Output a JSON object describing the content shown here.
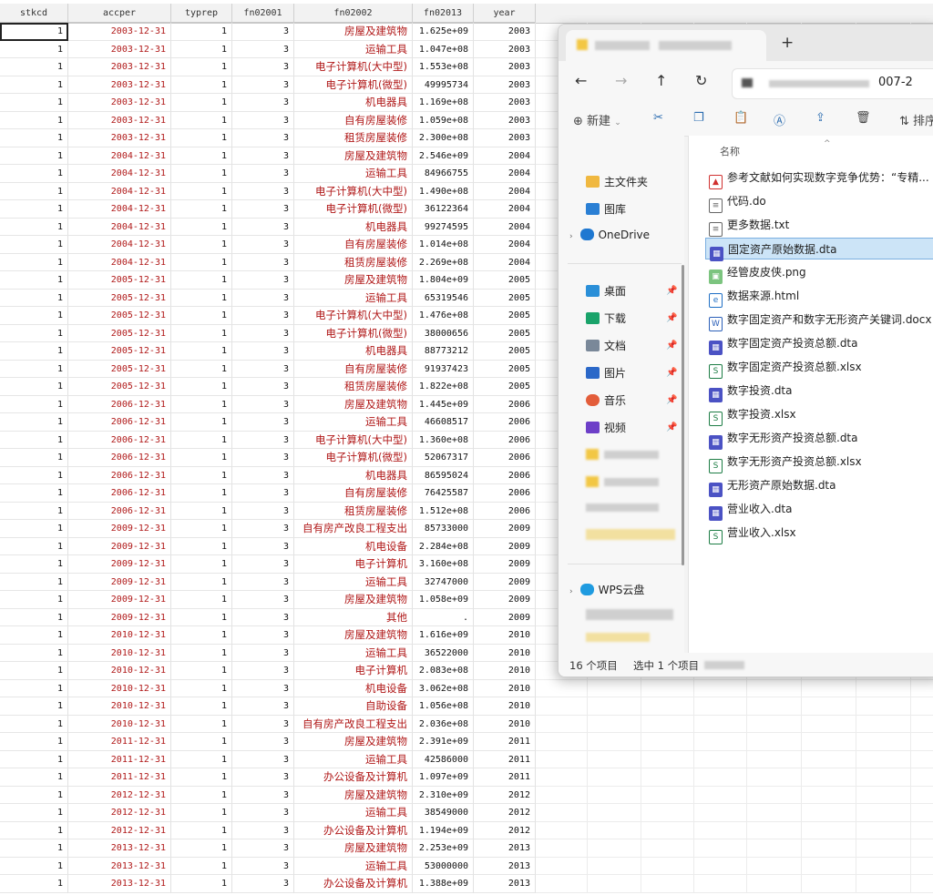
{
  "grid": {
    "columns": [
      "stkcd",
      "accper",
      "typrep",
      "fn02001",
      "fn02002",
      "fn02013",
      "year"
    ],
    "rows": [
      [
        "1",
        "2003-12-31",
        "1",
        "3",
        "房屋及建筑物",
        "1.625e+09",
        "2003"
      ],
      [
        "1",
        "2003-12-31",
        "1",
        "3",
        "运输工具",
        "1.047e+08",
        "2003"
      ],
      [
        "1",
        "2003-12-31",
        "1",
        "3",
        "电子计算机(大中型)",
        "1.553e+08",
        "2003"
      ],
      [
        "1",
        "2003-12-31",
        "1",
        "3",
        "电子计算机(微型)",
        "49995734",
        "2003"
      ],
      [
        "1",
        "2003-12-31",
        "1",
        "3",
        "机电器具",
        "1.169e+08",
        "2003"
      ],
      [
        "1",
        "2003-12-31",
        "1",
        "3",
        "自有房屋装修",
        "1.059e+08",
        "2003"
      ],
      [
        "1",
        "2003-12-31",
        "1",
        "3",
        "租赁房屋装修",
        "2.300e+08",
        "2003"
      ],
      [
        "1",
        "2004-12-31",
        "1",
        "3",
        "房屋及建筑物",
        "2.546e+09",
        "2004"
      ],
      [
        "1",
        "2004-12-31",
        "1",
        "3",
        "运输工具",
        "84966755",
        "2004"
      ],
      [
        "1",
        "2004-12-31",
        "1",
        "3",
        "电子计算机(大中型)",
        "1.490e+08",
        "2004"
      ],
      [
        "1",
        "2004-12-31",
        "1",
        "3",
        "电子计算机(微型)",
        "36122364",
        "2004"
      ],
      [
        "1",
        "2004-12-31",
        "1",
        "3",
        "机电器具",
        "99274595",
        "2004"
      ],
      [
        "1",
        "2004-12-31",
        "1",
        "3",
        "自有房屋装修",
        "1.014e+08",
        "2004"
      ],
      [
        "1",
        "2004-12-31",
        "1",
        "3",
        "租赁房屋装修",
        "2.269e+08",
        "2004"
      ],
      [
        "1",
        "2005-12-31",
        "1",
        "3",
        "房屋及建筑物",
        "1.804e+09",
        "2005"
      ],
      [
        "1",
        "2005-12-31",
        "1",
        "3",
        "运输工具",
        "65319546",
        "2005"
      ],
      [
        "1",
        "2005-12-31",
        "1",
        "3",
        "电子计算机(大中型)",
        "1.476e+08",
        "2005"
      ],
      [
        "1",
        "2005-12-31",
        "1",
        "3",
        "电子计算机(微型)",
        "38000656",
        "2005"
      ],
      [
        "1",
        "2005-12-31",
        "1",
        "3",
        "机电器具",
        "88773212",
        "2005"
      ],
      [
        "1",
        "2005-12-31",
        "1",
        "3",
        "自有房屋装修",
        "91937423",
        "2005"
      ],
      [
        "1",
        "2005-12-31",
        "1",
        "3",
        "租赁房屋装修",
        "1.822e+08",
        "2005"
      ],
      [
        "1",
        "2006-12-31",
        "1",
        "3",
        "房屋及建筑物",
        "1.445e+09",
        "2006"
      ],
      [
        "1",
        "2006-12-31",
        "1",
        "3",
        "运输工具",
        "46608517",
        "2006"
      ],
      [
        "1",
        "2006-12-31",
        "1",
        "3",
        "电子计算机(大中型)",
        "1.360e+08",
        "2006"
      ],
      [
        "1",
        "2006-12-31",
        "1",
        "3",
        "电子计算机(微型)",
        "52067317",
        "2006"
      ],
      [
        "1",
        "2006-12-31",
        "1",
        "3",
        "机电器具",
        "86595024",
        "2006"
      ],
      [
        "1",
        "2006-12-31",
        "1",
        "3",
        "自有房屋装修",
        "76425587",
        "2006"
      ],
      [
        "1",
        "2006-12-31",
        "1",
        "3",
        "租赁房屋装修",
        "1.512e+08",
        "2006"
      ],
      [
        "1",
        "2009-12-31",
        "1",
        "3",
        "自有房产改良工程支出",
        "85733000",
        "2009"
      ],
      [
        "1",
        "2009-12-31",
        "1",
        "3",
        "机电设备",
        "2.284e+08",
        "2009"
      ],
      [
        "1",
        "2009-12-31",
        "1",
        "3",
        "电子计算机",
        "3.160e+08",
        "2009"
      ],
      [
        "1",
        "2009-12-31",
        "1",
        "3",
        "运输工具",
        "32747000",
        "2009"
      ],
      [
        "1",
        "2009-12-31",
        "1",
        "3",
        "房屋及建筑物",
        "1.058e+09",
        "2009"
      ],
      [
        "1",
        "2009-12-31",
        "1",
        "3",
        "其他",
        ".",
        "2009"
      ],
      [
        "1",
        "2010-12-31",
        "1",
        "3",
        "房屋及建筑物",
        "1.616e+09",
        "2010"
      ],
      [
        "1",
        "2010-12-31",
        "1",
        "3",
        "运输工具",
        "36522000",
        "2010"
      ],
      [
        "1",
        "2010-12-31",
        "1",
        "3",
        "电子计算机",
        "2.083e+08",
        "2010"
      ],
      [
        "1",
        "2010-12-31",
        "1",
        "3",
        "机电设备",
        "3.062e+08",
        "2010"
      ],
      [
        "1",
        "2010-12-31",
        "1",
        "3",
        "自助设备",
        "1.056e+08",
        "2010"
      ],
      [
        "1",
        "2010-12-31",
        "1",
        "3",
        "自有房产改良工程支出",
        "2.036e+08",
        "2010"
      ],
      [
        "1",
        "2011-12-31",
        "1",
        "3",
        "房屋及建筑物",
        "2.391e+09",
        "2011"
      ],
      [
        "1",
        "2011-12-31",
        "1",
        "3",
        "运输工具",
        "42586000",
        "2011"
      ],
      [
        "1",
        "2011-12-31",
        "1",
        "3",
        "办公设备及计算机",
        "1.097e+09",
        "2011"
      ],
      [
        "1",
        "2012-12-31",
        "1",
        "3",
        "房屋及建筑物",
        "2.310e+09",
        "2012"
      ],
      [
        "1",
        "2012-12-31",
        "1",
        "3",
        "运输工具",
        "38549000",
        "2012"
      ],
      [
        "1",
        "2012-12-31",
        "1",
        "3",
        "办公设备及计算机",
        "1.194e+09",
        "2012"
      ],
      [
        "1",
        "2013-12-31",
        "1",
        "3",
        "房屋及建筑物",
        "2.253e+09",
        "2013"
      ],
      [
        "1",
        "2013-12-31",
        "1",
        "3",
        "运输工具",
        "53000000",
        "2013"
      ],
      [
        "1",
        "2013-12-31",
        "1",
        "3",
        "办公设备及计算机",
        "1.388e+09",
        "2013"
      ]
    ]
  },
  "explorer": {
    "new_tab_icon": "+",
    "address_suffix": "007-2",
    "nav": {
      "back": "←",
      "forward": "→",
      "up": "↑",
      "refresh": "↻"
    },
    "toolbar": {
      "new_label": "新建",
      "sort_label": "排序"
    },
    "sidebar": {
      "home": "主文件夹",
      "gallery": "图库",
      "onedrive": "OneDrive",
      "desktop": "桌面",
      "downloads": "下载",
      "documents": "文档",
      "pictures": "图片",
      "music": "音乐",
      "videos": "视频",
      "wps": "WPS云盘"
    },
    "column_name": "名称",
    "files": [
      {
        "name": "参考文献如何实现数字竞争优势：“专精...",
        "type": "pdf"
      },
      {
        "name": "代码.do",
        "type": "doc"
      },
      {
        "name": "更多数据.txt",
        "type": "txt"
      },
      {
        "name": "固定资产原始数据.dta",
        "type": "dta"
      },
      {
        "name": "经管皮皮侠.png",
        "type": "png"
      },
      {
        "name": "数据来源.html",
        "type": "html"
      },
      {
        "name": "数字固定资产和数字无形资产关键词.docx",
        "type": "word"
      },
      {
        "name": "数字固定资产投资总额.dta",
        "type": "dta"
      },
      {
        "name": "数字固定资产投资总额.xlsx",
        "type": "xlsx"
      },
      {
        "name": "数字投资.dta",
        "type": "dta"
      },
      {
        "name": "数字投资.xlsx",
        "type": "xlsx"
      },
      {
        "name": "数字无形资产投资总额.dta",
        "type": "dta"
      },
      {
        "name": "数字无形资产投资总额.xlsx",
        "type": "xlsx"
      },
      {
        "name": "无形资产原始数据.dta",
        "type": "dta"
      },
      {
        "name": "营业收入.dta",
        "type": "dta"
      },
      {
        "name": "营业收入.xlsx",
        "type": "xlsx"
      }
    ],
    "date_stub": "2",
    "status": {
      "count": "16 个项目",
      "selected": "选中 1 个项目"
    },
    "colors": {
      "accent": "#0067c0",
      "selection": "#cce4f7",
      "dta": "#4b52c4",
      "xlsx": "#1d7d45",
      "pdf": "#d0302f"
    }
  }
}
